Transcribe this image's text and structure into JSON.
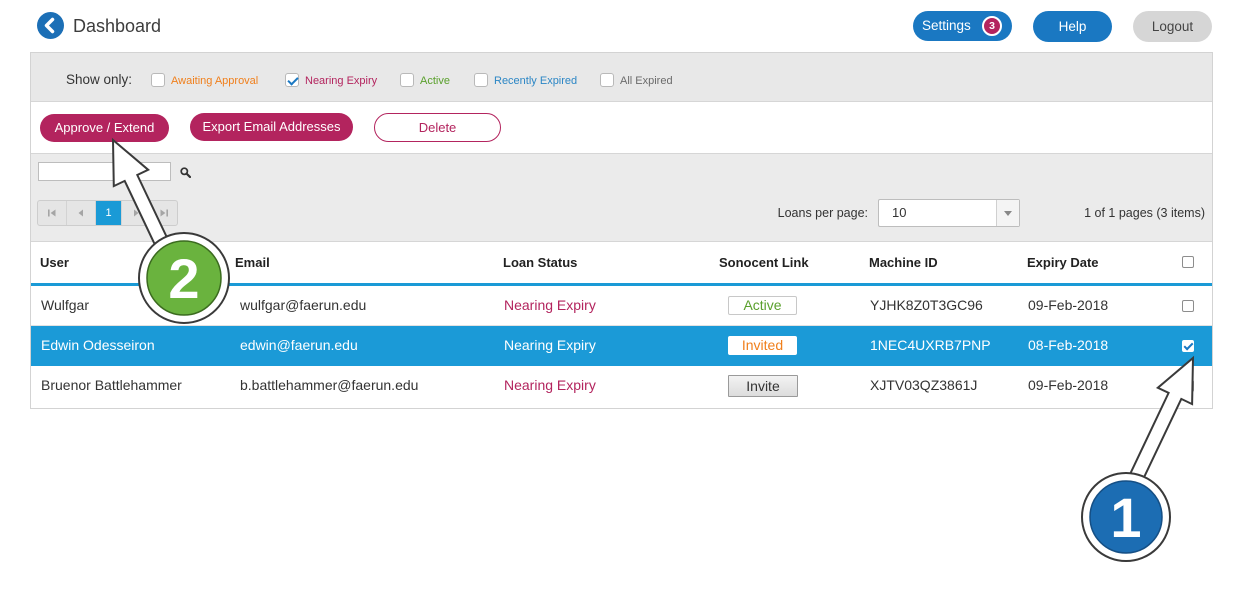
{
  "header": {
    "title": "Dashboard",
    "back_icon": "chevron-left-icon",
    "settings_label": "Settings",
    "settings_badge": "3",
    "help_label": "Help",
    "logout_label": "Logout"
  },
  "filters": {
    "label": "Show only:",
    "options": [
      {
        "label": "Awaiting Approval",
        "checked": false,
        "color": "#f07f1b"
      },
      {
        "label": "Nearing Expiry",
        "checked": true,
        "color": "#b3245e"
      },
      {
        "label": "Active",
        "checked": false,
        "color": "#5aa02c"
      },
      {
        "label": "Recently Expired",
        "checked": false,
        "color": "#2b86c5"
      },
      {
        "label": "All Expired",
        "checked": false,
        "color": "#6b6b6b"
      }
    ]
  },
  "actions": {
    "approve_label": "Approve / Extend",
    "export_label": "Export Email Addresses",
    "delete_label": "Delete"
  },
  "search": {
    "icon": "search-icon"
  },
  "pager": {
    "first_icon": "first-page-icon",
    "prev_icon": "prev-page-icon",
    "next_icon": "next-page-icon",
    "last_icon": "last-page-icon",
    "current_page": "1",
    "per_page_label": "Loans per page:",
    "per_page_value": "10",
    "summary": "1 of 1 pages (3 items)"
  },
  "table": {
    "columns": {
      "user": "User",
      "email": "Email",
      "status": "Loan Status",
      "link": "Sonocent Link",
      "machine_id": "Machine ID",
      "expiry": "Expiry Date"
    },
    "select_all_checked": false,
    "rows": [
      {
        "user": "Wulfgar",
        "email": "wulfgar@faerun.edu",
        "status": "Nearing Expiry",
        "link": "Active",
        "link_color": "#5aa02c",
        "machine_id": "YJHK8Z0T3GC96",
        "expiry": "09-Feb-2018",
        "selected": false
      },
      {
        "user": "Edwin Odesseiron",
        "email": "edwin@faerun.edu",
        "status": "Nearing Expiry",
        "link": "Invited",
        "link_color": "#f07f1b",
        "machine_id": "1NEC4UXRB7PNP",
        "expiry": "08-Feb-2018",
        "selected": true
      },
      {
        "user": "Bruenor Battlehammer",
        "email": "b.battlehammer@faerun.edu",
        "status": "Nearing Expiry",
        "link": "Invite",
        "machine_id": "XJTV03QZ3861J",
        "expiry": "09-Feb-2018",
        "selected": false
      }
    ]
  },
  "annotations": {
    "step_1": {
      "label": "1",
      "color": "#1c6db3"
    },
    "step_2": {
      "label": "2",
      "color": "#6ab33e"
    }
  },
  "colors": {
    "primary": "#1a78c2",
    "accent": "#b3245e",
    "selected_row": "#1b9ad7",
    "status_text": "#b3245e",
    "table_accent": "#1a9ad6"
  }
}
